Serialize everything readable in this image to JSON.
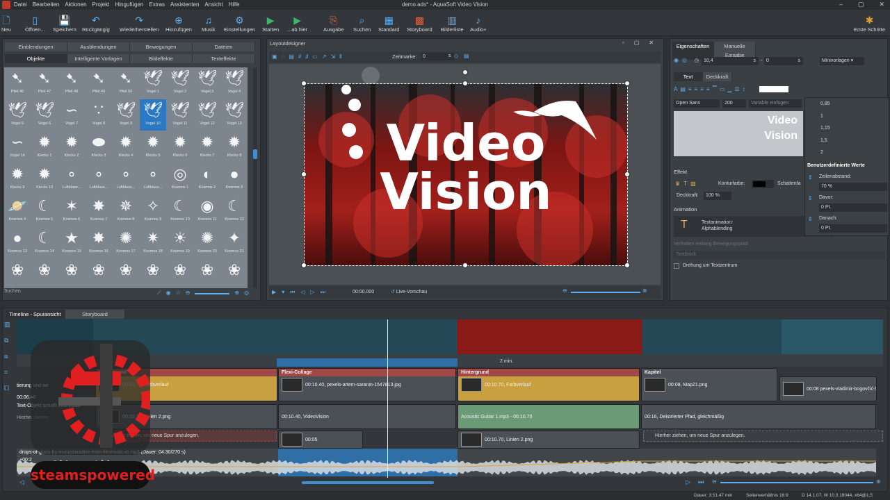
{
  "app": {
    "title": "demo.ads* - AquaSoft Video Vision",
    "menu": [
      "Datei",
      "Bearbeiten",
      "Aktionen",
      "Projekt",
      "Hingufügen",
      "Extras",
      "Assistenten",
      "Ansicht",
      "Hilfe"
    ]
  },
  "toolbar": [
    {
      "label": "Neu",
      "icon": "new-icon"
    },
    {
      "label": "Öffnen...",
      "icon": "open-icon"
    },
    {
      "label": "Speichern",
      "icon": "save-icon"
    },
    {
      "label": "Rückgängig",
      "icon": "undo-icon"
    },
    {
      "label": "Wiederherstellen",
      "icon": "redo-icon"
    },
    {
      "label": "Hinzufügen",
      "icon": "add-icon"
    },
    {
      "label": "Musik",
      "icon": "music-icon"
    },
    {
      "label": "Einstellungen",
      "icon": "settings-icon"
    },
    {
      "label": "Starten",
      "icon": "play-icon"
    },
    {
      "label": "...ab hier",
      "icon": "play-from-here-icon"
    },
    {
      "label": "Ausgabe",
      "icon": "output-icon"
    },
    {
      "label": "Suchen",
      "icon": "search-icon"
    },
    {
      "label": "Standard",
      "icon": "standard-view-icon"
    },
    {
      "label": "Storyboard",
      "icon": "storyboard-icon"
    },
    {
      "label": "Bilderliste",
      "icon": "image-list-icon"
    },
    {
      "label": "Audio+",
      "icon": "audio-plus-icon"
    },
    {
      "label": "Erste Schritte",
      "icon": "first-steps-icon"
    }
  ],
  "library": {
    "tabs_row1": [
      "Einblendungen",
      "Ausblendungen",
      "Bewegungen",
      "Dateien"
    ],
    "tabs_row2": [
      "Objekte",
      "Intelligente Vorlagen",
      "Bildeffekte",
      "Texteffekte"
    ],
    "selected_tab": "Objekte",
    "items": [
      "Pfeil 46",
      "Pfeil 47",
      "Pfeil 48",
      "Pfeil 49",
      "Pfeil 50",
      "Vogel 1",
      "Vogel 2",
      "Vogel 3",
      "Vogel 4",
      "Vogel 5",
      "Vogel 6",
      "Vogel 7",
      "Vogel 8",
      "Vogel 9",
      "Vogel 10",
      "Vogel 11",
      "Vogel 12",
      "Vogel 13",
      "Vogel 14",
      "Klecks 1",
      "Klecks 2",
      "Klecks 3",
      "Klecks 4",
      "Klecks 5",
      "Klecks 6",
      "Klecks 7",
      "Klecks 8",
      "Klecks 9",
      "Klecks 10",
      "Luftblase...",
      "Luftblase...",
      "Luftblase...",
      "Luftblase...",
      "Kosmos 1",
      "Kosmos 2",
      "Kosmos 3",
      "Kosmos 4",
      "Kosmos 5",
      "Kosmos 6",
      "Kosmos 7",
      "Kosmos 8",
      "Kosmos 9",
      "Kosmos 10",
      "Kosmos 11",
      "Kosmos 12",
      "Kosmos 13",
      "Kosmos 14",
      "Kosmos 15",
      "Kosmos 16",
      "Kosmos 17",
      "Kosmos 18",
      "Kosmos 19",
      "Kosmos 20",
      "Kosmos 21",
      "",
      "",
      "",
      "",
      "",
      "",
      "",
      "",
      ""
    ],
    "selected_item": "Vogel 10",
    "search_placeholder": "Suchen"
  },
  "layout": {
    "title": "Layoutdesigner",
    "zeitmarke_label": "Zeitmarke:",
    "zeitmarke_value": "0",
    "zeitmarke_unit": "s",
    "canvas_text_line1": "Video",
    "canvas_text_line2": "Vision",
    "time": "00:00.000",
    "preview_label": "Live-Vorschau"
  },
  "properties": {
    "tabs": [
      "Eigenschaften",
      "Manuelle Eingabe"
    ],
    "subtabs": [
      "Text",
      "Deckkraft"
    ],
    "x_value": "10,4",
    "y_value": "0",
    "unit": "s",
    "preset": "Minivorlagen",
    "font": "Open Sans",
    "font_size": "200",
    "variable_placeholder": "Variable einfügen",
    "preview_line1": "Video",
    "preview_line2": "Vision",
    "effekt_label": "Effekt",
    "kontur_label": "Konturfarbe:",
    "schatten_label": "Schattenfa",
    "deckkraft_label": "Deckkraft:",
    "deckkraft_value": "100 %",
    "animation_label": "Animation",
    "textanimation": "Textanimation:",
    "alphablending": "Alphablending",
    "verhalten": "Verhalten entlang Bewegungspfad",
    "textblock": "Textblock",
    "drehung": "Drehung um Textzentrum",
    "line_height_options": [
      "0,85",
      "1",
      "1,15",
      "1,5",
      "2"
    ],
    "custom_values": "Benutzerdefinierte Werte",
    "zeilenabstand_label": "Zeilenabstand:",
    "zeilenabstand_value": "70 %",
    "davor_label": "Davor:",
    "davor_value": "0 Pt.",
    "danach_label": "Danach:",
    "danach_value": "0 Pt."
  },
  "timeline": {
    "tabs": [
      "Timeline - Spuransicht",
      "Storyboard"
    ],
    "marker": "2 min.",
    "clips": [
      {
        "id": "c1",
        "header": "Hintergrund",
        "text": "00:10.70, Farbverlauf",
        "color": "#c8a040"
      },
      {
        "id": "c2",
        "header": "Flexi-Collage",
        "text": "00:10.40, pexels-artem-saranin-1547813.jpg",
        "color": "#4a5055"
      },
      {
        "id": "c3",
        "header": "Hintergrund",
        "text": "00:10.70, Farbverlauf",
        "color": "#c8a040"
      },
      {
        "id": "c4",
        "header": "Kapitel",
        "text": "00:08, Map21.png",
        "color": "#4a5055"
      },
      {
        "id": "c5",
        "header": "",
        "text": "00:08 pexels-vladimir-bogovčić-5",
        "color": "#4a5055"
      },
      {
        "id": "c6",
        "header": "",
        "text": "00:10.70, Linien 2.png",
        "color": "#4a5055"
      },
      {
        "id": "c7",
        "header": "",
        "text": "00:10.40, VideoVision",
        "color": "#4a5055"
      },
      {
        "id": "c8",
        "header": "",
        "text": "Acoustic Guitar 1.mp3 - 00:10.70",
        "color": "#6b9a77"
      },
      {
        "id": "c9",
        "header": "",
        "text": "00:16, Dekorierter Pfad, gleichmäßig",
        "color": "#4a5055"
      },
      {
        "id": "c10",
        "header": "",
        "text": "00:05",
        "color": "#4a5055"
      },
      {
        "id": "c11",
        "header": "",
        "text": "00:10.70, Linien 2.png",
        "color": "#4a5055"
      }
    ],
    "left_texts": [
      "tierung und we",
      "00:06.40",
      "Text-Objekt schafft eine zusät",
      "Hierher ziehen,"
    ],
    "drop_hint": "Hierher ziehen, um neue Spur anzulegen.",
    "audio": "drops-of-glass-by-musicparadise-from-filmmusic-io.mp3 (Dauer: 04:30/270 s)",
    "audio_prefix": "+00:2"
  },
  "status": {
    "dauer": "Dauer: 3:51.47 min",
    "seitenverhaeltnis": "Seitenverhältnis 16:9",
    "version": "D 14.1.07, W 10.0.19044, x64@1,5"
  },
  "watermark": "steamspowered"
}
